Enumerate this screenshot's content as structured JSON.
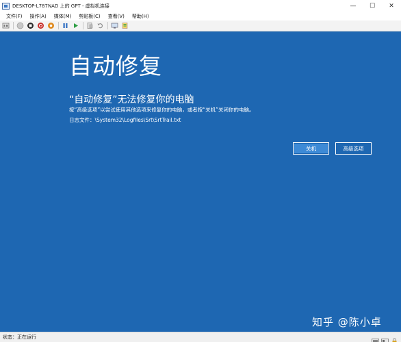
{
  "window": {
    "title": "DESKTOP-L787NAD 上的 GPT - 虚拟机连接",
    "controls": [
      "—",
      "☐",
      "✕"
    ]
  },
  "menu": {
    "items": [
      "文件(F)",
      "操作(A)",
      "媒体(M)",
      "剪贴板(C)",
      "查看(V)",
      "帮助(H)"
    ]
  },
  "toolbar": {
    "icons": [
      "ctrl-alt-del-icon",
      "start-icon",
      "stop-icon",
      "shutdown-icon",
      "save-state-icon",
      "pause-icon",
      "resume-icon",
      "checkpoint-icon",
      "revert-icon",
      "enhanced-session-icon",
      "share-icon"
    ]
  },
  "recovery": {
    "title": "自动修复",
    "subtitle": "“自动修复”无法修复你的电脑",
    "description": "按“高级选项”以尝试使用其他选项来修复你的电脑，或者按“关机”关闭你的电脑。",
    "log_file": "日志文件：\\System32\\Logfiles\\Srt\\SrtTrail.txt",
    "shutdown_label": "关机",
    "advanced_label": "高级选项"
  },
  "watermark": "知乎 @陈小卓",
  "status": {
    "text": "状态：正在运行"
  },
  "colors": {
    "screen_bg": "#1e67b2",
    "button_focus": "#3d8ad6"
  }
}
